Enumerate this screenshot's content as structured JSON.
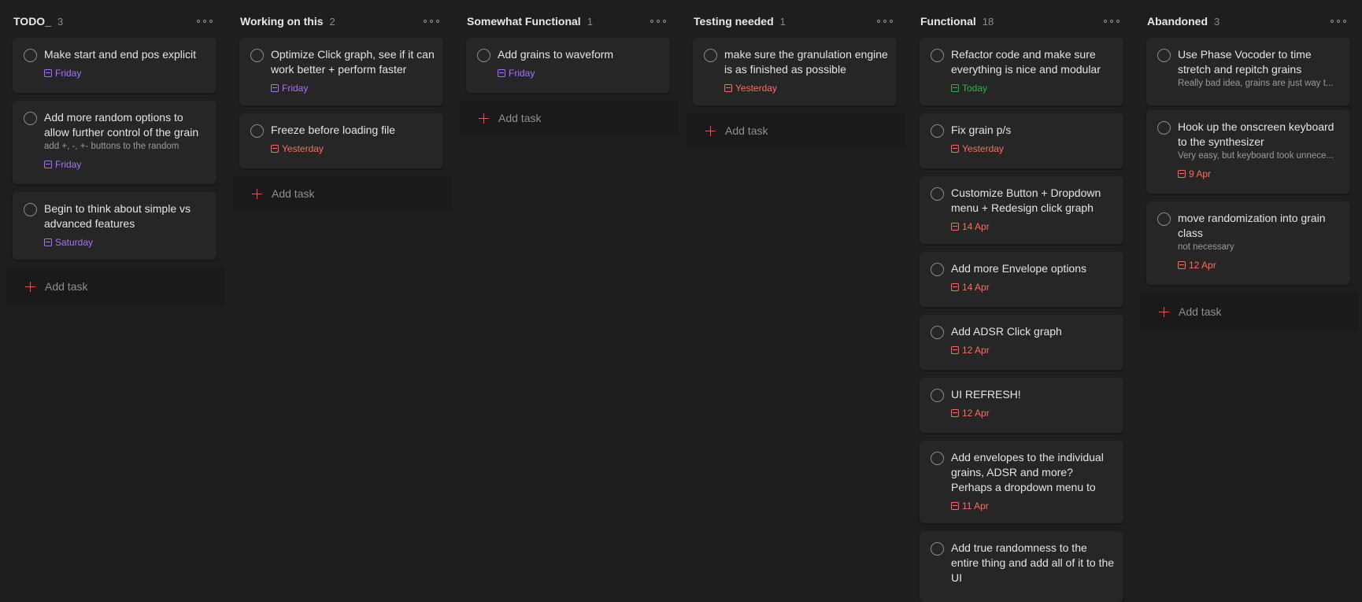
{
  "colors": {
    "purple": "#a970ff",
    "red": "#ff6b5f",
    "green": "#25b84c",
    "plus": "#e05a4f"
  },
  "icons": {
    "column_menu": "more-horizontal-icon",
    "checkbox": "circle-checkbox-icon",
    "date": "calendar-icon",
    "add": "plus-icon"
  },
  "add_task_label": "Add task",
  "columns": [
    {
      "title": "TODO_",
      "count": "3",
      "tasks": [
        {
          "title": "Make start and end pos explicit",
          "date": "Friday",
          "date_color": "purple"
        },
        {
          "title": "Add more random options to allow further control of the grain",
          "desc": "add +, -, +- buttons to the random",
          "date": "Friday",
          "date_color": "purple"
        },
        {
          "title": "Begin to think about simple vs advanced features",
          "date": "Saturday",
          "date_color": "purple"
        }
      ]
    },
    {
      "title": "Working on this",
      "count": "2",
      "tasks": [
        {
          "title": "Optimize Click graph, see if it can work better + perform faster",
          "date": "Friday",
          "date_color": "purple"
        },
        {
          "title": "Freeze before loading file",
          "date": "Yesterday",
          "date_color": "red"
        }
      ]
    },
    {
      "title": "Somewhat Functional",
      "count": "1",
      "tasks": [
        {
          "title": "Add grains to waveform",
          "date": "Friday",
          "date_color": "purple"
        }
      ]
    },
    {
      "title": "Testing needed",
      "count": "1",
      "tasks": [
        {
          "title": "make sure the granulation engine is as finished as possible",
          "date": "Yesterday",
          "date_color": "red"
        }
      ]
    },
    {
      "title": "Functional",
      "count": "18",
      "tasks": [
        {
          "title": "Refactor code and make sure everything is nice and modular",
          "date": "Today",
          "date_color": "green"
        },
        {
          "title": "Fix grain p/s",
          "date": "Yesterday",
          "date_color": "red"
        },
        {
          "title": "Customize Button + Dropdown menu + Redesign click graph",
          "date": "14 Apr",
          "date_color": "red"
        },
        {
          "title": "Add more Envelope options",
          "date": "14 Apr",
          "date_color": "red"
        },
        {
          "title": "Add ADSR Click graph",
          "date": "12 Apr",
          "date_color": "red"
        },
        {
          "title": "UI REFRESH!",
          "date": "12 Apr",
          "date_color": "red"
        },
        {
          "title": "Add envelopes to the individual grains, ADSR and more? Perhaps a dropdown menu to control this",
          "date": "11 Apr",
          "date_color": "red"
        },
        {
          "title": "Add true randomness to the entire thing and add all of it to the UI"
        }
      ]
    },
    {
      "title": "Abandoned",
      "count": "3",
      "tasks": [
        {
          "title": "Use Phase Vocoder to time stretch and repitch grains",
          "desc": "Really bad idea, grains are just way t..."
        },
        {
          "title": "Hook up the onscreen keyboard to the synthesizer",
          "desc": "Very easy, but keyboard took unnece...",
          "date": "9 Apr",
          "date_color": "red"
        },
        {
          "title": "move randomization into grain class",
          "desc": "not necessary",
          "date": "12 Apr",
          "date_color": "red"
        }
      ]
    }
  ]
}
